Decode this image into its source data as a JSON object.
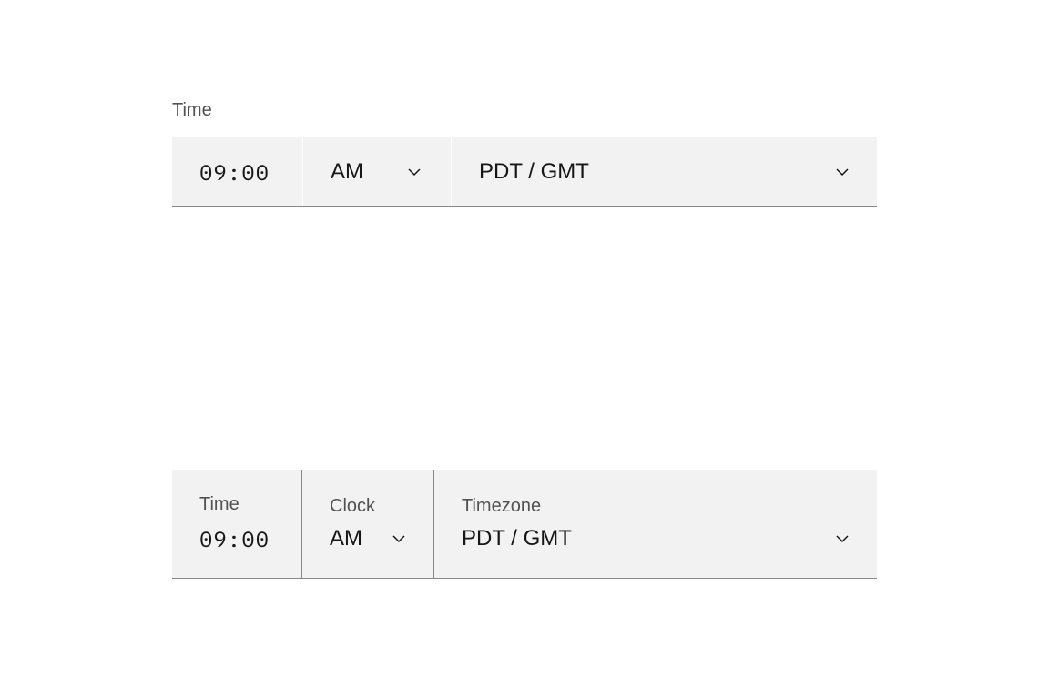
{
  "variant1": {
    "label": "Time",
    "time_value": "09:00",
    "period_value": "AM",
    "timezone_value": "PDT / GMT"
  },
  "variant2": {
    "time_label": "Time",
    "time_value": "09:00",
    "period_label": "Clock",
    "period_value": "AM",
    "timezone_label": "Timezone",
    "timezone_value": "PDT / GMT"
  }
}
